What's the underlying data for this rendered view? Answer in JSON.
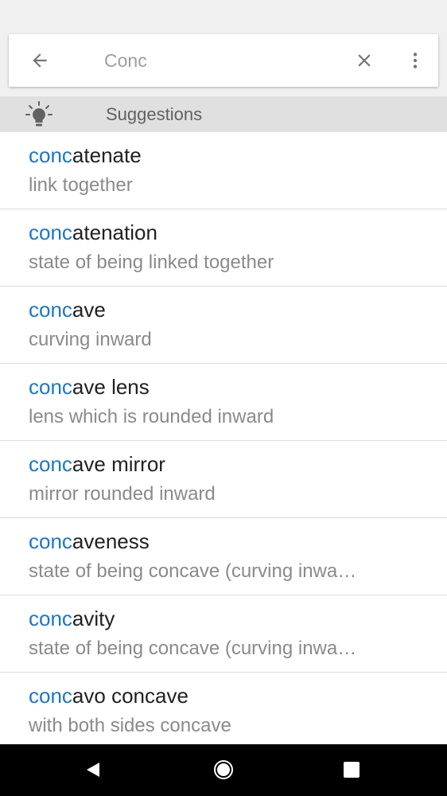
{
  "search": {
    "value": "Conc",
    "back_icon": "arrow-left-icon",
    "clear_icon": "close-icon",
    "more_icon": "more-vert-icon"
  },
  "suggestions_header": {
    "title": "Suggestions",
    "icon": "lightbulb-icon"
  },
  "items": [
    {
      "match": "conc",
      "rest": "atenate",
      "definition": "link together"
    },
    {
      "match": "conc",
      "rest": "atenation",
      "definition": "state of being linked together"
    },
    {
      "match": "conc",
      "rest": "ave",
      "definition": "curving inward"
    },
    {
      "match": "conc",
      "rest": "ave lens",
      "definition": "lens which is rounded inward"
    },
    {
      "match": "conc",
      "rest": "ave mirror",
      "definition": "mirror rounded inward"
    },
    {
      "match": "conc",
      "rest": "aveness",
      "definition": "state of being concave (curving inwa…"
    },
    {
      "match": "conc",
      "rest": "avity",
      "definition": "state of being concave (curving inwa…"
    },
    {
      "match": "conc",
      "rest": "avo concave",
      "definition": "with both sides concave"
    }
  ],
  "nav": {
    "back_icon": "nav-back-icon",
    "home_icon": "nav-home-icon",
    "recents_icon": "nav-recents-icon"
  },
  "colors": {
    "highlight": "#1976d2",
    "header_bg": "#e0e0e0",
    "definition": "#8a8a8a"
  }
}
